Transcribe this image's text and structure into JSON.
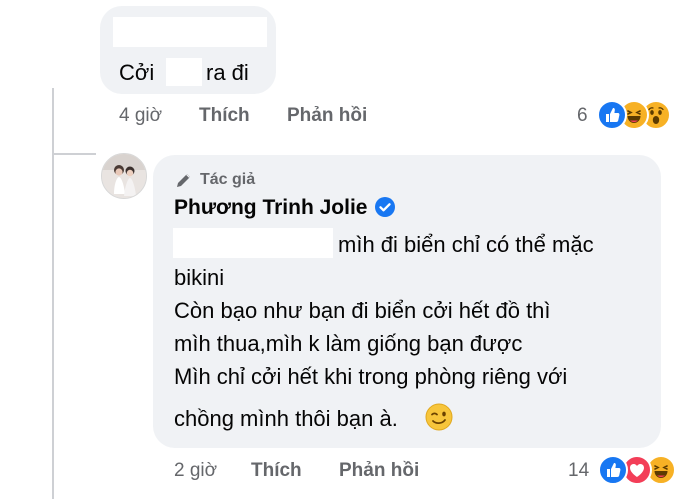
{
  "comment1": {
    "text_start": "Cởi",
    "text_end": "ra đi",
    "time": "4 giờ",
    "like": "Thích",
    "reply": "Phản hồi",
    "reaction_count": "6",
    "reactions": [
      "like-icon",
      "haha-icon",
      "wow-icon"
    ]
  },
  "comment2": {
    "author_tag": "Tác giả",
    "author": "Phương Trinh Jolie",
    "verified": true,
    "lines": [
      "mìh đi biển chỉ có thể mặc",
      "bikini",
      "Còn bạo như bạn đi biển cởi hết đồ thì",
      "mìh thua,mìh k làm giống bạn được",
      "Mìh chỉ cởi hết khi trong phòng riêng với",
      "chồng mình thôi bạn à."
    ],
    "emoji": "winking-face-icon",
    "time": "2 giờ",
    "like": "Thích",
    "reply": "Phản hồi",
    "reaction_count": "14",
    "reactions": [
      "like-icon",
      "love-icon",
      "haha-icon"
    ]
  },
  "colors": {
    "bubble": "#f0f2f5",
    "meta": "#65676b",
    "like_blue": "#1877f2",
    "love_red": "#f33e58",
    "haha_yellow": "#f7b125"
  }
}
